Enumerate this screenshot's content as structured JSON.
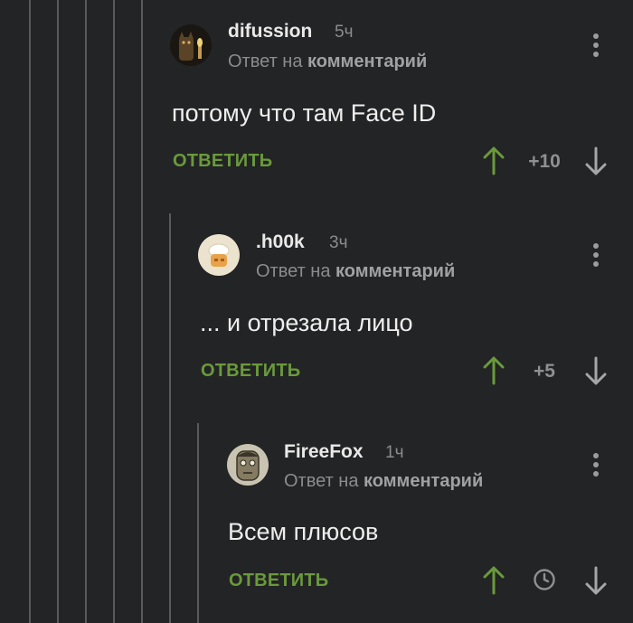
{
  "comments": [
    {
      "username": "difussion",
      "time": "5ч",
      "reply_prefix": "Ответ на",
      "reply_target": "комментарий",
      "text": "потому что там Face ID",
      "reply_label": "ОТВЕТИТЬ",
      "rating": "+10"
    },
    {
      "username": ".h00k",
      "time": "3ч",
      "reply_prefix": "Ответ на",
      "reply_target": "комментарий",
      "text": "... и отрезала лицо",
      "reply_label": "ОТВЕТИТЬ",
      "rating": "+5"
    },
    {
      "username": "FireeFox",
      "time": "1ч",
      "reply_prefix": "Ответ на",
      "reply_target": "комментарий",
      "text": "Всем плюсов",
      "reply_label": "ОТВЕТИТЬ",
      "rating": ""
    }
  ],
  "icons": {
    "menu": "more-vertical-icon",
    "upvote": "arrow-up-icon",
    "downvote": "arrow-down-icon",
    "pending": "clock-icon"
  },
  "colors": {
    "background": "#232425",
    "accent_green": "#6a9a3c",
    "thread_line": "#585a5c"
  }
}
